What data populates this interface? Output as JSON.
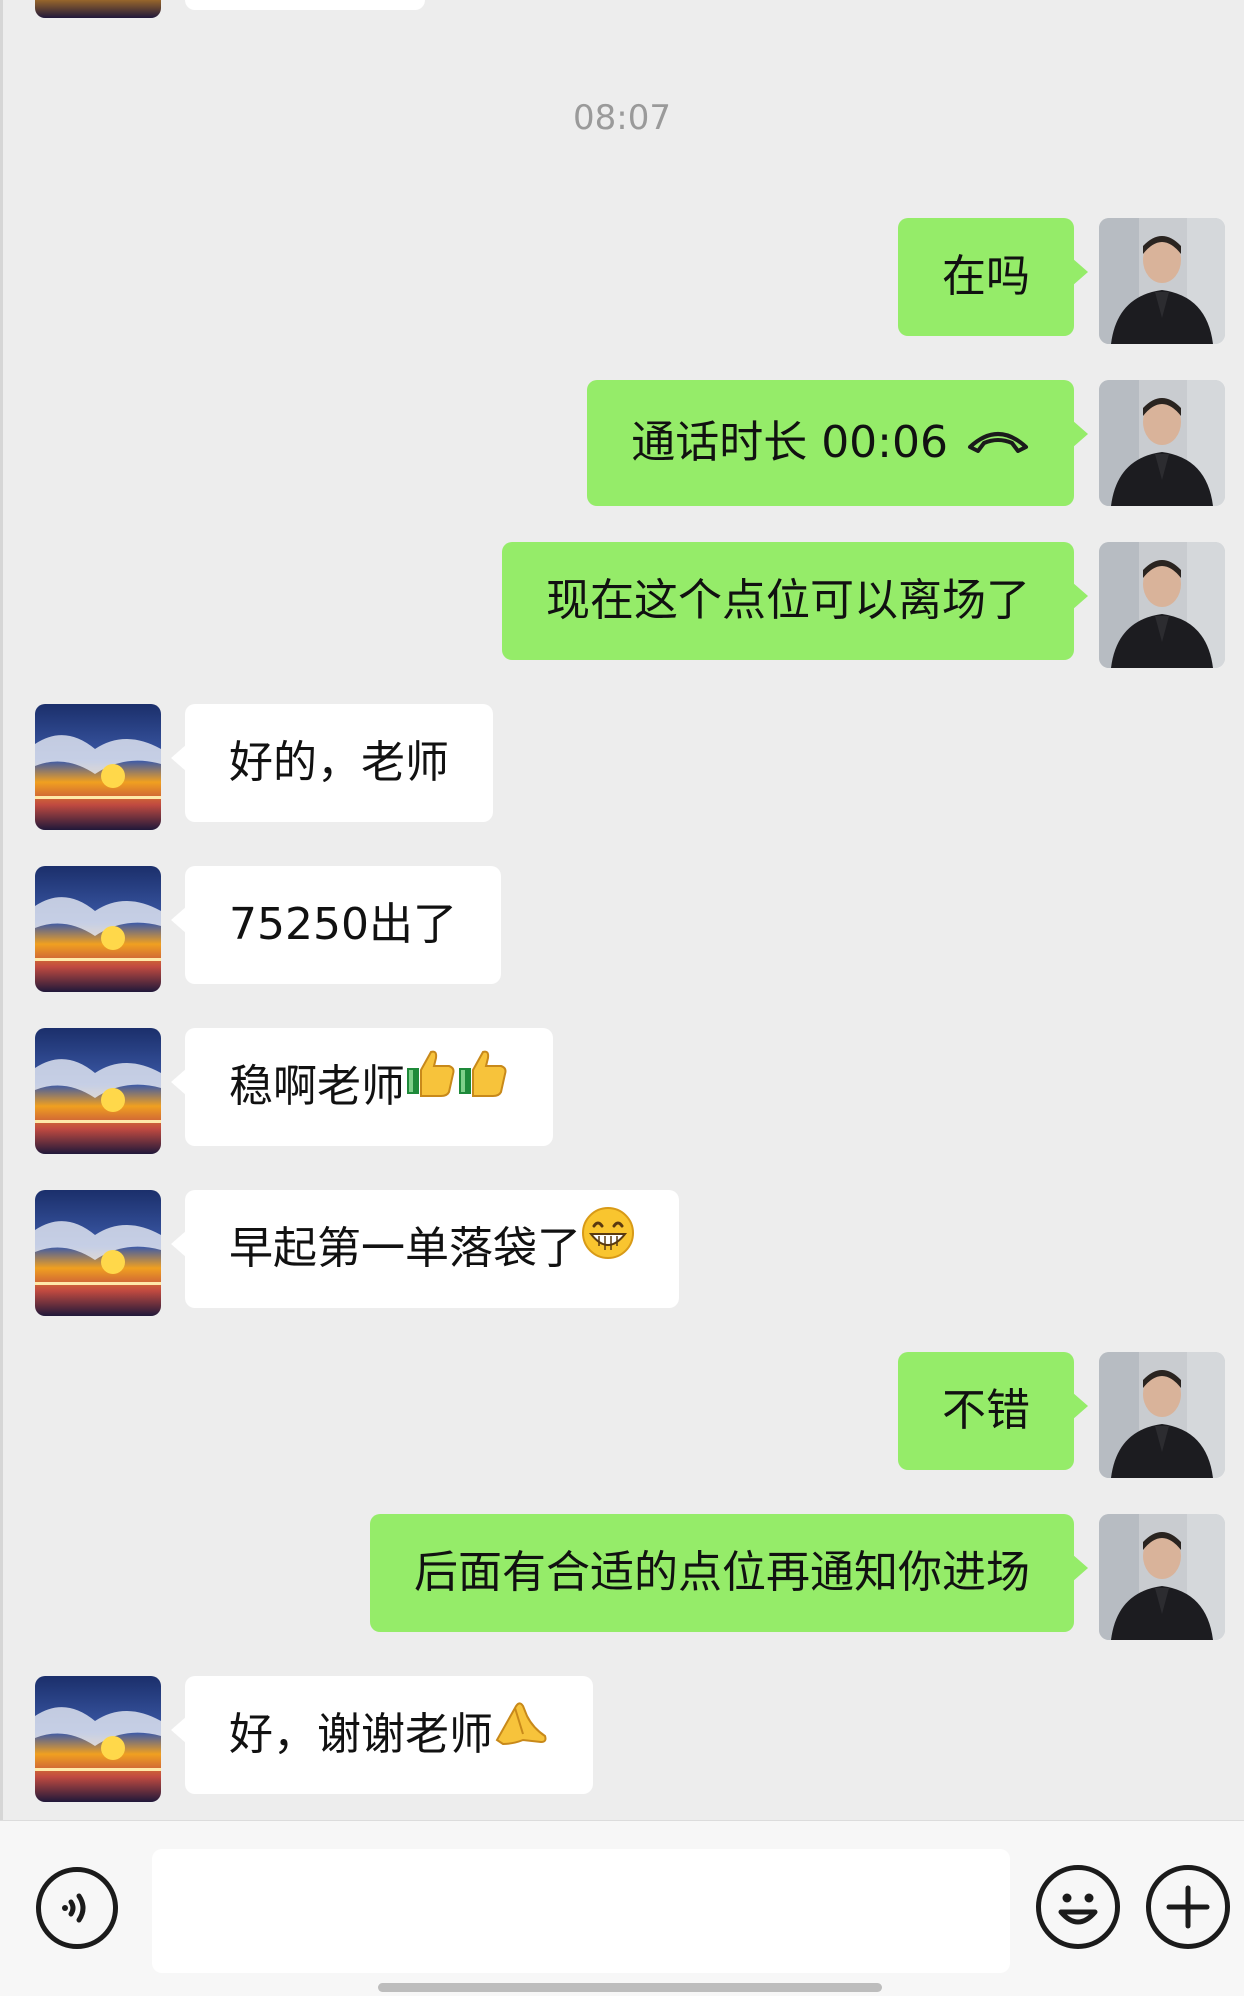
{
  "timestamp": "08:07",
  "messages": [
    {
      "side": "out",
      "text": "在吗"
    },
    {
      "side": "out",
      "text": "通话时长 00:06",
      "icon": "phone-hangup-icon"
    },
    {
      "side": "out",
      "text": "现在这个点位可以离场了"
    },
    {
      "side": "in",
      "text": "好的，老师"
    },
    {
      "side": "in",
      "text": "75250出了"
    },
    {
      "side": "in",
      "text": "稳啊老师",
      "emoji": [
        "thumbs-up-icon",
        "thumbs-up-icon"
      ]
    },
    {
      "side": "in",
      "text": "早起第一单落袋了",
      "emoji": [
        "grinning-face-icon"
      ]
    },
    {
      "side": "out",
      "text": "不错"
    },
    {
      "side": "out",
      "text": "后面有合适的点位再通知你进场"
    },
    {
      "side": "in",
      "text": "好，谢谢老师",
      "emoji": [
        "folded-hands-icon"
      ]
    }
  ],
  "input": {
    "placeholder": ""
  },
  "bottom_bar": {
    "icons": [
      "voice-icon",
      "emoji-icon",
      "plus-icon"
    ]
  }
}
